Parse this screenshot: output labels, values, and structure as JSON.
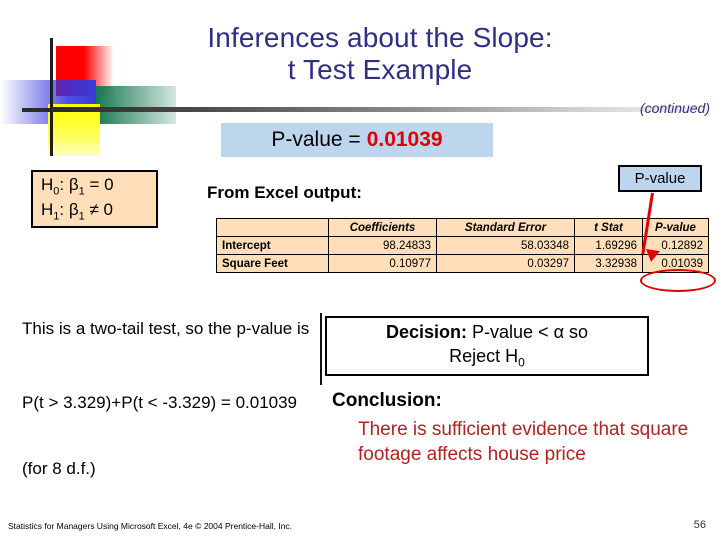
{
  "slide": {
    "title_line1": "Inferences about the Slope:",
    "title_line2": "t Test Example",
    "continued_label": "(continued)",
    "title_color": "#2f2f84"
  },
  "pvalue_banner": {
    "label": "P-value = ",
    "value": "0.01039",
    "value_color": "#dd0000",
    "background": "#bed5ee"
  },
  "hypotheses": {
    "null_prefix": "H",
    "null_sub": "0",
    "null_text": ": β",
    "null_sub2": "1",
    "null_tail": " = 0",
    "alt_prefix": "H",
    "alt_sub": "1",
    "alt_text": ": β",
    "alt_sub2": "1",
    "alt_tail": " ≠ 0",
    "background": "#ffdfb9"
  },
  "excel": {
    "label": "From Excel output:",
    "columns": [
      "",
      "Coefficients",
      "Standard Error",
      "t Stat",
      "P-value"
    ],
    "rows": [
      {
        "name": "Intercept",
        "coefficients": "98.24833",
        "standard_error": "58.03348",
        "t_stat": "1.69296",
        "p_value": "0.12892"
      },
      {
        "name": "Square Feet",
        "coefficients": "0.10977",
        "standard_error": "0.03297",
        "t_stat": "3.32938",
        "p_value": "0.01039"
      }
    ],
    "highlight_cell": "0.01039",
    "highlight_color": "#e00000",
    "background": "#ffdfb9"
  },
  "callout": {
    "label": "P-value",
    "background": "#bed5ee"
  },
  "left_notes": {
    "note1": "This is a two-tail test, so the p-value is",
    "note2": "P(t > 3.329)+P(t < -3.329) = 0.01039",
    "note3": "(for 8 d.f.)"
  },
  "decision": {
    "bold_label": "Decision:",
    "text": " P-value < α  so",
    "line2_prefix": "Reject H",
    "line2_sub": "0"
  },
  "conclusion": {
    "heading": "Conclusion:",
    "body": "There is sufficient evidence that square footage affects house price",
    "body_color": "#b22222"
  },
  "footer": {
    "credit": "Statistics for Managers Using Microsoft Excel, 4e © 2004 Prentice-Hall, Inc.",
    "page_number": "56"
  }
}
